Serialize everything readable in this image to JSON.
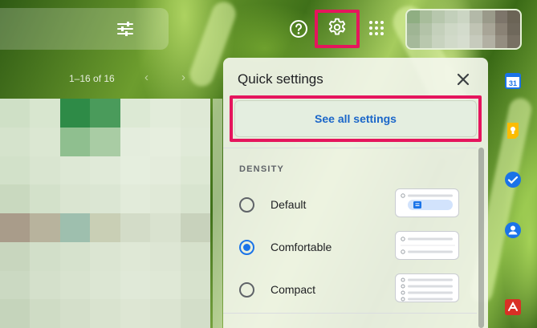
{
  "header": {
    "filter_icon": "tune-icon",
    "help_icon": "help-circle-icon",
    "settings_icon": "gear-icon",
    "apps_icon": "apps-grid-icon",
    "highlight_color": "#e5155d"
  },
  "toolbar": {
    "pager_text": "1–16 of 16",
    "prev_icon": "chevron-left-icon",
    "next_icon": "chevron-right-icon"
  },
  "quick_settings": {
    "title": "Quick settings",
    "close_icon": "close-icon",
    "see_all_label": "See all settings",
    "density_heading": "DENSITY",
    "density_options": [
      {
        "label": "Default",
        "selected": false
      },
      {
        "label": "Comfortable",
        "selected": true
      },
      {
        "label": "Compact",
        "selected": false
      }
    ],
    "accent_color": "#1a73e8"
  },
  "side_panel": {
    "apps": [
      {
        "name": "calendar-icon",
        "color": "#1a73e8"
      },
      {
        "name": "keep-icon",
        "color": "#fbbc04"
      },
      {
        "name": "tasks-icon",
        "color": "#1a73e8"
      },
      {
        "name": "contacts-icon",
        "color": "#1a73e8"
      },
      {
        "name": "app-extension-icon",
        "color": "#d93025"
      }
    ]
  }
}
